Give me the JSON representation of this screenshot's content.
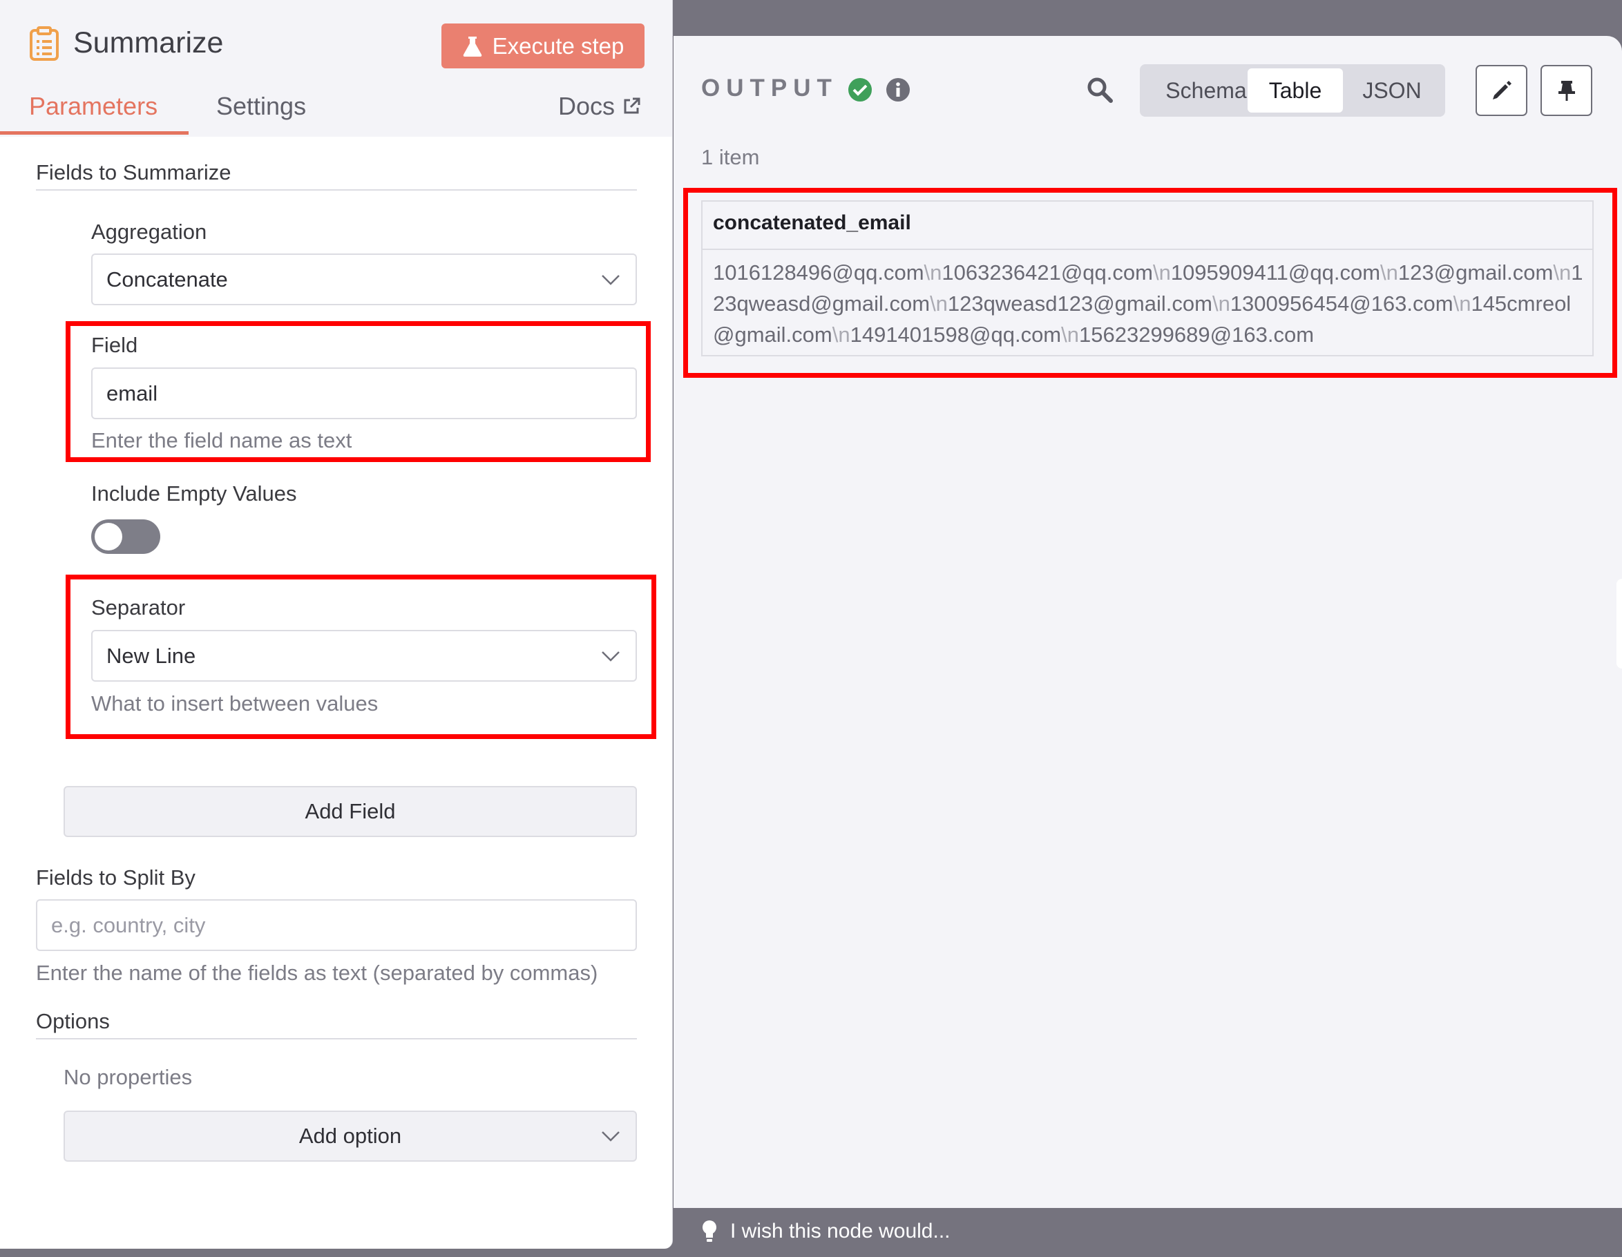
{
  "node": {
    "title": "Summarize",
    "execute_label": "Execute step",
    "accent_color": "#ea8070"
  },
  "tabs": {
    "parameters": "Parameters",
    "settings": "Settings",
    "docs": "Docs"
  },
  "fields_to_summarize": {
    "title": "Fields to Summarize",
    "aggregation": {
      "label": "Aggregation",
      "value": "Concatenate"
    },
    "field": {
      "label": "Field",
      "value": "email",
      "hint": "Enter the field name as text"
    },
    "include_empty": {
      "label": "Include Empty Values",
      "enabled": false
    },
    "separator": {
      "label": "Separator",
      "value": "New Line",
      "hint": "What to insert between values"
    },
    "add_field_label": "Add Field"
  },
  "fields_to_split_by": {
    "title": "Fields to Split By",
    "placeholder": "e.g. country, city",
    "hint": "Enter the name of the fields as text (separated by commas)"
  },
  "options": {
    "title": "Options",
    "empty_text": "No properties",
    "add_option_label": "Add option"
  },
  "output": {
    "label": "OUTPUT",
    "status": "success",
    "views": [
      "Schema",
      "Table",
      "JSON"
    ],
    "active_view": "Table",
    "item_count": "1 item",
    "column": "concatenated_email",
    "value_parts": [
      "1016128496@qq.com",
      "1063236421@qq.com",
      "1095909411@qq.com",
      "123@gmail.com",
      "123qweasd@gmail.com",
      "123qweasd123@gmail.com",
      "1300956454@163.com",
      "145cmreol@gmail.com",
      "1491401598@qq.com",
      "15623299689@163.com"
    ],
    "escape_text": "\\n"
  },
  "feedback": {
    "text": "I wish this node would..."
  },
  "icons": {
    "node": "clipboard-list-icon",
    "execute": "flask-icon",
    "docs": "external-link-icon",
    "status": "check-circle-icon",
    "info": "info-circle-icon",
    "search": "search-icon",
    "edit": "pencil-icon",
    "pin": "pin-icon",
    "feedback": "lightbulb-icon"
  }
}
